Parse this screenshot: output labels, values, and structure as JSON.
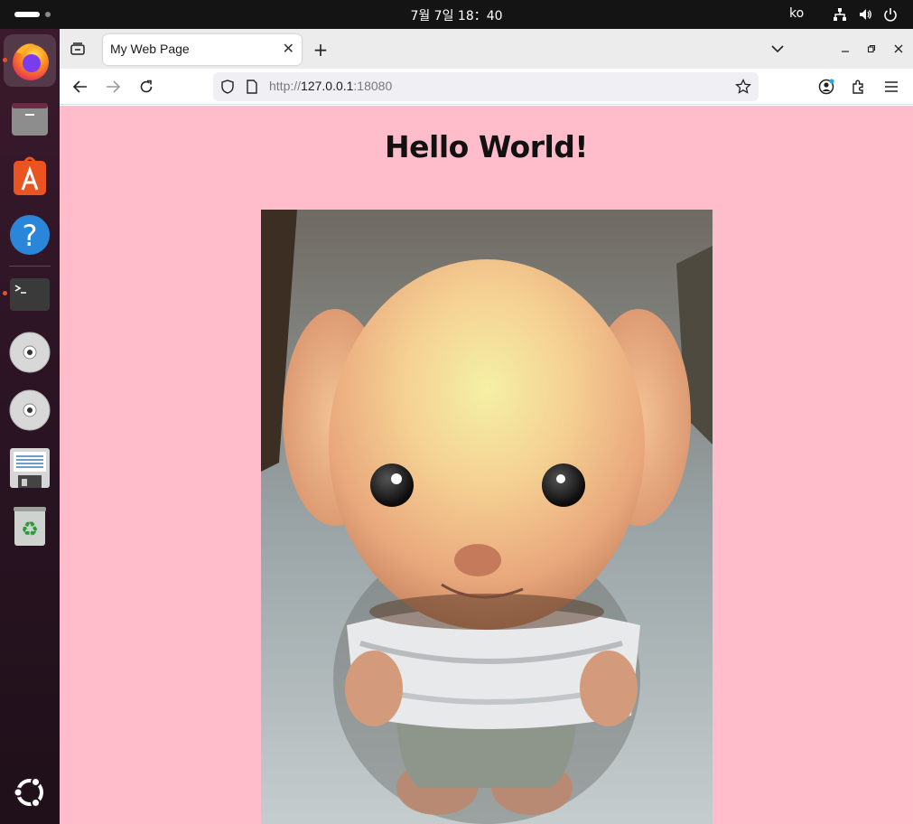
{
  "system": {
    "clock": "7월 7일  18：40",
    "language": "ko"
  },
  "dock": {
    "items": [
      {
        "name": "firefox",
        "icon": "firefox-icon"
      },
      {
        "name": "files",
        "icon": "folder-icon"
      },
      {
        "name": "app-center",
        "icon": "app-store-icon"
      },
      {
        "name": "help",
        "icon": "help-icon"
      },
      {
        "name": "terminal",
        "icon": "terminal-icon"
      },
      {
        "name": "disc-1",
        "icon": "cd-icon"
      },
      {
        "name": "disc-2",
        "icon": "cd-icon"
      },
      {
        "name": "save-drive",
        "icon": "floppy-icon"
      },
      {
        "name": "trash",
        "icon": "trash-icon"
      },
      {
        "name": "show-apps",
        "icon": "ubuntu-logo-icon"
      }
    ]
  },
  "browser": {
    "tab": {
      "title": "My Web Page"
    },
    "url": {
      "scheme": "http://",
      "host": "127.0.0.1",
      "port": ":18080"
    }
  },
  "page": {
    "heading": "Hello World!",
    "image": {
      "description_icon": "plush-toy-photo"
    },
    "background": "#ffbccb"
  }
}
